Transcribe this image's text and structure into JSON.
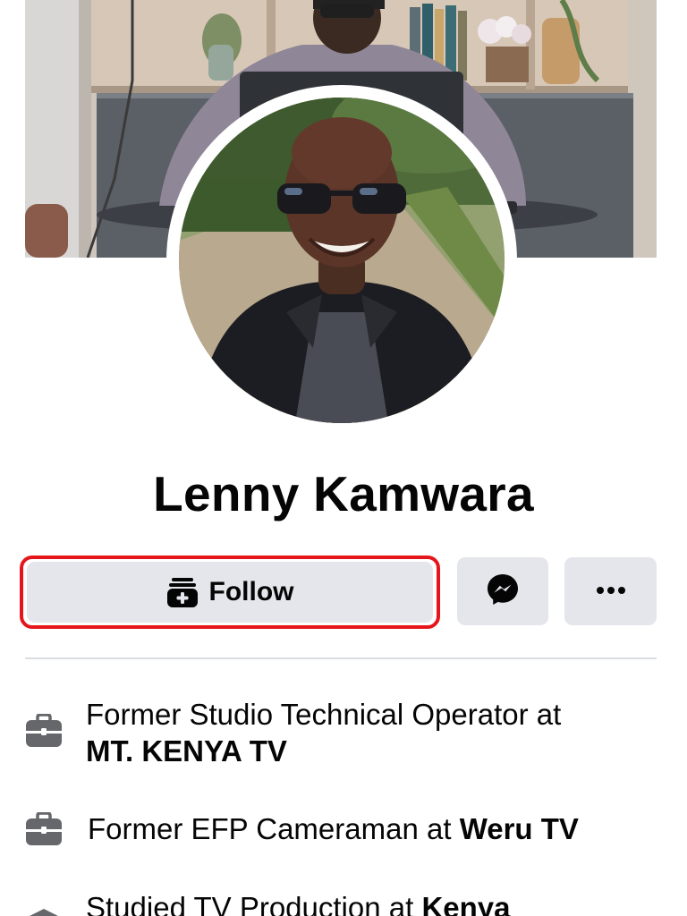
{
  "profile": {
    "name": "Lenny Kamwara"
  },
  "actions": {
    "follow_label": "Follow",
    "follow_icon": "follow-add-icon",
    "messenger_icon": "messenger-icon",
    "more_icon": "more-options-icon"
  },
  "intro": {
    "items": [
      {
        "icon": "briefcase-icon",
        "prefix": "Former Studio Technical Operator at",
        "emphasis": "MT. KENYA TV"
      },
      {
        "icon": "briefcase-icon",
        "prefix": "Former EFP Cameraman at ",
        "emphasis": "Weru TV"
      },
      {
        "icon": "graduation-cap-icon",
        "prefix": "Studied TV Production at ",
        "emphasis": "Kenya"
      }
    ]
  },
  "colors": {
    "highlight_outline": "#e4161c",
    "button_bg": "#e4e6eb",
    "icon_gray": "#65676b",
    "text": "#050505"
  }
}
